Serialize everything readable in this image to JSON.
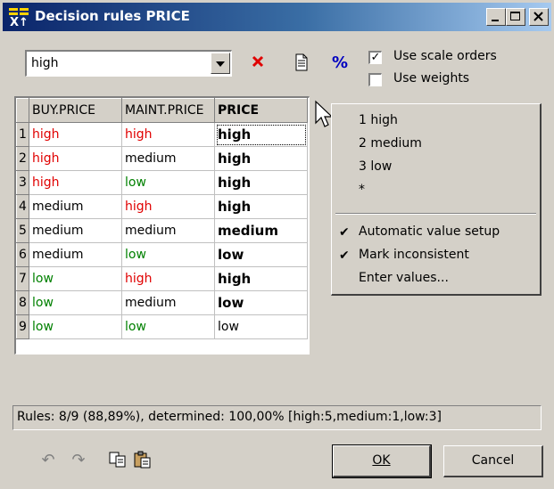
{
  "window": {
    "title": "Decision rules PRICE",
    "controls": [
      "minimize-icon",
      "maximize-icon",
      "close-icon"
    ]
  },
  "toolbar": {
    "combo_value": "high",
    "icons": [
      "delete-icon",
      "document-icon",
      "percent-icon"
    ],
    "use_scale_orders": {
      "label": "Use scale orders",
      "checked": true
    },
    "use_weights": {
      "label": "Use weights",
      "checked": false
    }
  },
  "grid": {
    "columns": [
      "BUY.PRICE",
      "MAINT.PRICE",
      "PRICE"
    ],
    "rows": [
      {
        "num": "1",
        "buy": "high",
        "maint": "high",
        "price": "high"
      },
      {
        "num": "2",
        "buy": "high",
        "maint": "medium",
        "price": "high"
      },
      {
        "num": "3",
        "buy": "high",
        "maint": "low",
        "price": "high"
      },
      {
        "num": "4",
        "buy": "medium",
        "maint": "high",
        "price": "high"
      },
      {
        "num": "5",
        "buy": "medium",
        "maint": "medium",
        "price": "medium"
      },
      {
        "num": "6",
        "buy": "medium",
        "maint": "low",
        "price": "low"
      },
      {
        "num": "7",
        "buy": "low",
        "maint": "high",
        "price": "high"
      },
      {
        "num": "8",
        "buy": "low",
        "maint": "medium",
        "price": "low"
      },
      {
        "num": "9",
        "buy": "low",
        "maint": "low",
        "price": "low"
      }
    ]
  },
  "context_menu": {
    "values": [
      "1 high",
      "2 medium",
      "3 low",
      "*"
    ],
    "options": [
      {
        "label": "Automatic value setup",
        "checked": true
      },
      {
        "label": "Mark inconsistent",
        "checked": true
      },
      {
        "label": "Enter values...",
        "checked": false
      }
    ]
  },
  "status": {
    "text": "Rules: 8/9 (88,89%), determined: 100,00% [high:5,medium:1,low:3]"
  },
  "bottom": {
    "icons": [
      "undo-icon",
      "redo-icon",
      "copy-icon",
      "paste-icon"
    ],
    "ok_label": "OK",
    "cancel_label": "Cancel"
  },
  "colors": {
    "high": "#e00000",
    "medium": "#000000",
    "low": "#008000",
    "title_bar": "#0a246a"
  }
}
